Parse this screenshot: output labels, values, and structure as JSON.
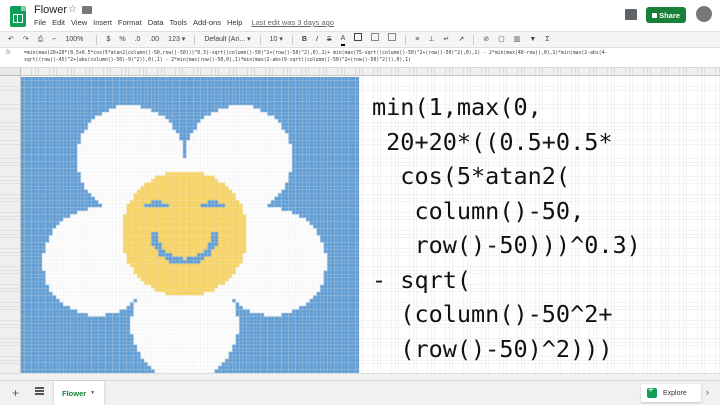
{
  "doc": {
    "title": "Flower",
    "last_edit": "Last edit was 3 days ago"
  },
  "menu": [
    "File",
    "Edit",
    "View",
    "Insert",
    "Format",
    "Data",
    "Tools",
    "Add-ons",
    "Help"
  ],
  "share": {
    "label": "Share"
  },
  "toolbar": {
    "undo": "↶",
    "redo": "↷",
    "print": "⎙",
    "paint": "⌐",
    "zoom": "100%",
    "currency": "$",
    "percent": "%",
    "decimal_less": ".0",
    "decimal_more": ".00",
    "more_formats": "123 ▾",
    "font": "Default (Ari... ▾",
    "font_size": "10 ▾",
    "bold": "B",
    "italic": "I",
    "strike": "S",
    "text_color": "A",
    "align": "≡",
    "valign": "⊥",
    "wrap": "↵",
    "rotate": "↗",
    "link": "⊘",
    "comment": "▢",
    "chart": "▥",
    "filter": "▼",
    "functions": "Σ"
  },
  "formula_bar": {
    "fx": "fx",
    "line1": "=min(max(20+20*(0.5+0.5*cos(5*atan2(column()-50,row()-50)))^0.3)-sqrt((column()-50)^2+(row()-50)^2),0),1)+ min(max(75-sqrt((column()-50)^2+(row()-50)^2),0),1) - 2*min(max(40-row(),0),1)*min(max(2-abs(4-",
    "line2": "sqrt((row()-45)^2+(abs(column()-50)-9)^2)),0),1) - 2*min(max(row()-50,0),1)*min(max(2-abs(9-sqrt((column()-50)^2+(row()-50)^2))),0),1)"
  },
  "overlay_formula": [
    "min(1,max(0,",
    " 20+20*((0.5+0.5*",
    "  cos(5*atan2(",
    "   column()-50,",
    "   row()-50)))^0.3)",
    "- sqrt(",
    "  (column()-50^2+",
    "  (row()-50)^2)))"
  ],
  "sheet_tab": {
    "name": "Flower"
  },
  "explore": {
    "label": "Explore"
  },
  "colors": {
    "sky": "#5b9bd5",
    "petal": "#ffffff",
    "center": "#fad35c",
    "face": "#5b9bd5",
    "grid_line": "#c9c9c9",
    "brand": "#188038"
  }
}
